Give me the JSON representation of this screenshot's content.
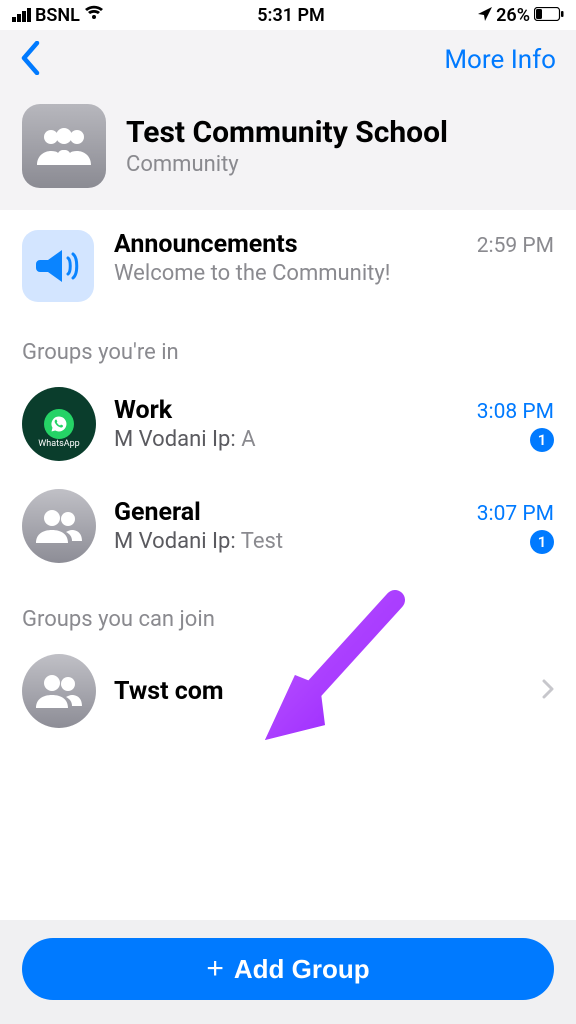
{
  "status": {
    "carrier": "BSNL",
    "time": "5:31 PM",
    "battery_pct": "26%"
  },
  "nav": {
    "more_info": "More Info"
  },
  "community": {
    "title": "Test Community School",
    "subtitle": "Community"
  },
  "announcements": {
    "title": "Announcements",
    "time": "2:59 PM",
    "message": "Welcome to the Community!"
  },
  "sections": {
    "in": "Groups you're in",
    "join": "Groups you can join"
  },
  "groups_in": [
    {
      "name": "Work",
      "time": "3:08 PM",
      "sender": "M Vodani Ip: ",
      "message": "A",
      "badge": "1",
      "avatar_text": "WhatsApp"
    },
    {
      "name": "General",
      "time": "3:07 PM",
      "sender": "M Vodani Ip: ",
      "message": "Test",
      "badge": "1"
    }
  ],
  "groups_join": [
    {
      "name": "Twst com"
    }
  ],
  "add_group_label": "Add Group"
}
